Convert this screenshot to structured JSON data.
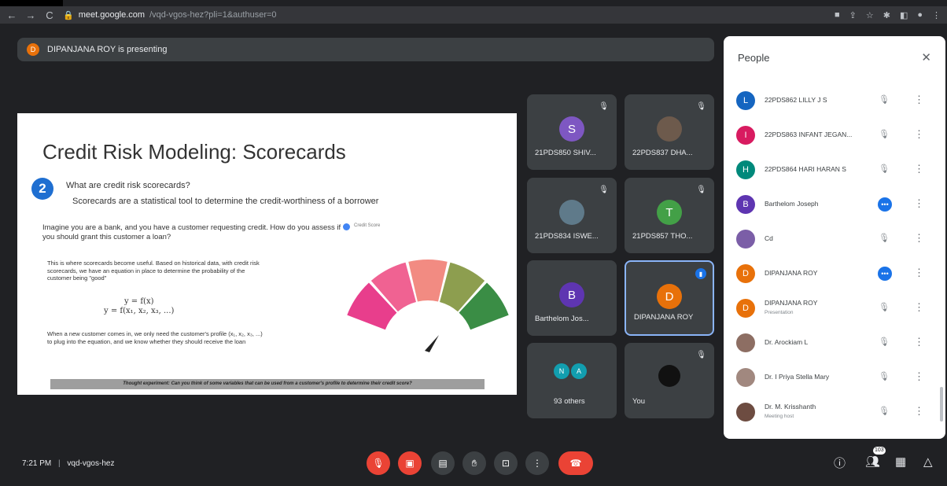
{
  "browser": {
    "back": "←",
    "forward": "→",
    "reload": "C",
    "url_host": "meet.google.com",
    "url_path": "/vqd-vgos-hez?pli=1&authuser=0"
  },
  "banner": {
    "initial": "D",
    "text": "DIPANJANA ROY is presenting",
    "color": "#e8710a"
  },
  "slide": {
    "title": "Credit Risk Modeling: Scorecards",
    "number": "2",
    "question": "What are credit risk scorecards?",
    "answer": "Scorecards are a statistical tool to determine the credit-worthiness of a borrower",
    "intro": "Imagine you are a bank, and you have a customer requesting credit. How do you assess if you should grant this customer a loan?",
    "legend": "Credit Score",
    "para1": "This is where scorecards become useful. Based on historical data, with credit risk scorecards, we have an equation in place to determine the probability of the customer being \"good\"",
    "formula1": "y = f(x)",
    "formula2": "y = f(x₁, x₂, x₃, ...)",
    "para2": "When a new customer comes in, we only need the customer's profile (x₁, x₂, x₃, ...) to plug into the equation, and we know whether they should receive the loan",
    "thought": "Thought experiment: Can you think of some variables that can be used from a customer's profile to determine their credit score?",
    "gauge_colors": [
      "#e83e8c",
      "#f06292",
      "#f28b82",
      "#8d9e4f",
      "#3a8d45"
    ]
  },
  "tiles": [
    {
      "label": "21PDS850 SHIV...",
      "initial": "S",
      "color": "#7e57c2"
    },
    {
      "label": "22PDS837 DHA...",
      "initial": "",
      "color": "#6d5a4c"
    },
    {
      "label": "21PDS834 ISWE...",
      "initial": "",
      "color": "#5f7a8a"
    },
    {
      "label": "21PDS857 THO...",
      "initial": "T",
      "color": "#43a047"
    },
    {
      "label": "Barthelom Jos...",
      "initial": "B",
      "color": "#5e35b1"
    },
    {
      "label": "DIPANJANA ROY",
      "initial": "D",
      "color": "#e8710a"
    },
    {
      "label": "93 others",
      "initial_a": "N",
      "initial_b": "A"
    },
    {
      "label": "You"
    }
  ],
  "people": {
    "title": "People",
    "close": "✕",
    "list": [
      {
        "name": "22PDS862 LILLY J S",
        "initial": "L",
        "color": "#1565c0",
        "status": "muted"
      },
      {
        "name": "22PDS863 INFANT JEGAN...",
        "initial": "I",
        "color": "#d81b60",
        "status": "muted"
      },
      {
        "name": "22PDS864 HARI HARAN S",
        "initial": "H",
        "color": "#00897b",
        "status": "muted"
      },
      {
        "name": "Barthelom Joseph",
        "initial": "B",
        "color": "#5e35b1",
        "status": "speaking"
      },
      {
        "name": "Cd",
        "initial": "",
        "color": "#7b5ea7",
        "status": "muted"
      },
      {
        "name": "DIPANJANA ROY",
        "initial": "D",
        "color": "#e8710a",
        "status": "speaking"
      },
      {
        "name": "DIPANJANA ROY",
        "sub": "Presentation",
        "initial": "D",
        "color": "#e8710a",
        "status": "muted"
      },
      {
        "name": "Dr. Arockiam L",
        "initial": "",
        "color": "#8d6e63",
        "status": "muted"
      },
      {
        "name": "Dr. I Priya Stella Mary",
        "initial": "",
        "color": "#a1887f",
        "status": "muted"
      },
      {
        "name": "Dr. M. Krisshanth",
        "sub": "Meeting host",
        "initial": "",
        "color": "#6d4c41",
        "status": "muted"
      }
    ]
  },
  "footer": {
    "time": "7:21 PM",
    "separator": "|",
    "code": "vqd-vgos-hez",
    "people_count": "103"
  }
}
